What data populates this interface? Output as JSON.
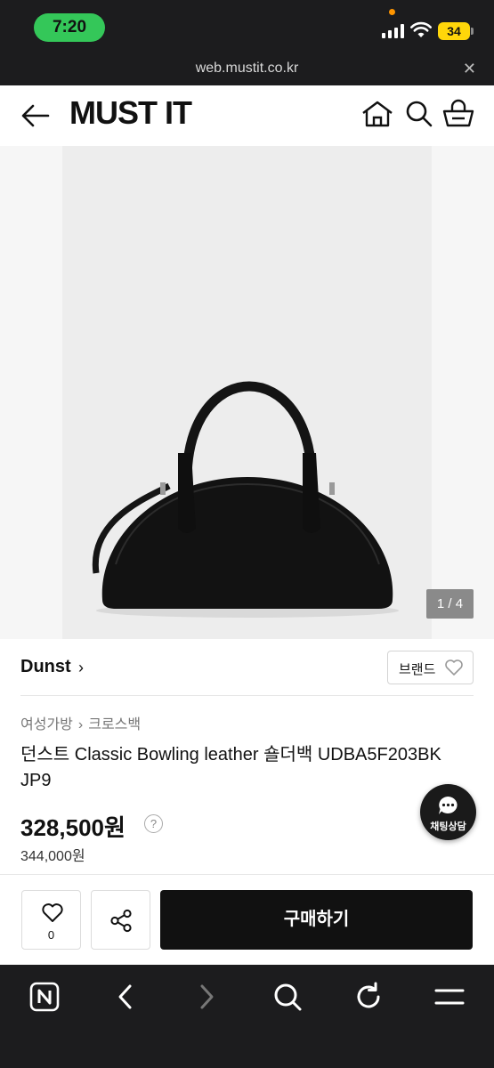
{
  "status_bar": {
    "time": "7:20",
    "battery": "34",
    "icons": [
      "signal-icon",
      "wifi-icon",
      "battery-icon"
    ]
  },
  "browser": {
    "url": "web.mustit.co.kr",
    "close_label": "✕"
  },
  "header": {
    "logo": "MUST IT",
    "icons": [
      "back-arrow-icon",
      "home-icon",
      "search-icon",
      "cart-icon"
    ]
  },
  "gallery": {
    "counter": "1 / 4"
  },
  "product": {
    "brand": "Dunst",
    "brand_chevron": "›",
    "brand_button_label": "브랜드",
    "breadcrumb": [
      "여성가방",
      "크로스백"
    ],
    "breadcrumb_sep": "›",
    "title": "던스트 Classic Bowling leather 숄더백 UDBA5F203BK JP9",
    "price": "328,500원",
    "price_help": "?",
    "original_price": "344,000원"
  },
  "chat": {
    "label": "채팅상담"
  },
  "action_bar": {
    "wish_count": "0",
    "buy_label": "구매하기"
  },
  "browser_toolbar": {
    "icons": [
      "naver-icon",
      "back-icon",
      "forward-icon",
      "search-icon",
      "reload-icon",
      "menu-icon"
    ]
  },
  "colors": {
    "status_bar_bg": "#1c1c1e",
    "time_pill": "#34c759",
    "battery": "#ffd60a",
    "buy_button": "#111111"
  }
}
